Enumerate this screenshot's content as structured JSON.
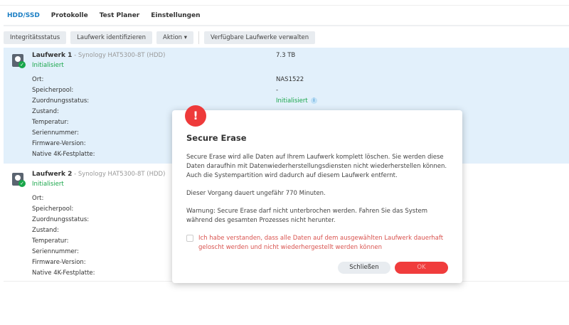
{
  "tabs": [
    "HDD/SSD",
    "Protokolle",
    "Test Planer",
    "Einstellungen"
  ],
  "toolbar": {
    "integrity": "Integritätsstatus",
    "identify": "Laufwerk identifizieren",
    "action": "Aktion ▾",
    "manage": "Verfügbare Laufwerke verwalten"
  },
  "labels": [
    "Ort:",
    "Speicherpool:",
    "Zuordnungsstatus:",
    "Zustand:",
    "Temperatur:",
    "Seriennummer:",
    "Firmware-Version:",
    "Native 4K-Festplatte:"
  ],
  "drives": [
    {
      "name": "Laufwerk 1",
      "model": " - Synology HAT5300-8T (HDD)",
      "status": "Initialisiert",
      "size": "7.3 TB",
      "location": "NAS1522",
      "pool": "-",
      "assignment": "Initialisiert"
    },
    {
      "name": "Laufwerk 2",
      "model": " - Synology HAT5300-8T (HDD)",
      "status": "Initialisiert"
    }
  ],
  "dialog": {
    "title": "Secure Erase",
    "p1": "Secure Erase wird alle Daten auf Ihrem Laufwerk komplett löschen. Sie werden diese Daten daraufhin mit Datenwiederherstellungsdiensten nicht wiederherstellen können. Auch die Systempartition wird dadurch auf diesem Laufwerk entfernt.",
    "p2": "Dieser Vorgang dauert ungefähr 770 Minuten.",
    "p3": "Warnung: Secure Erase darf nicht unterbrochen werden. Fahren Sie das System während des gesamten Prozesses nicht herunter.",
    "confirm": "Ich habe verstanden, dass alle Daten auf dem ausgewählten Laufwerk dauerhaft geloscht werden und nicht wiederhergestellt werden können",
    "close": "Schließen",
    "ok": "OK",
    "alert_glyph": "!"
  }
}
